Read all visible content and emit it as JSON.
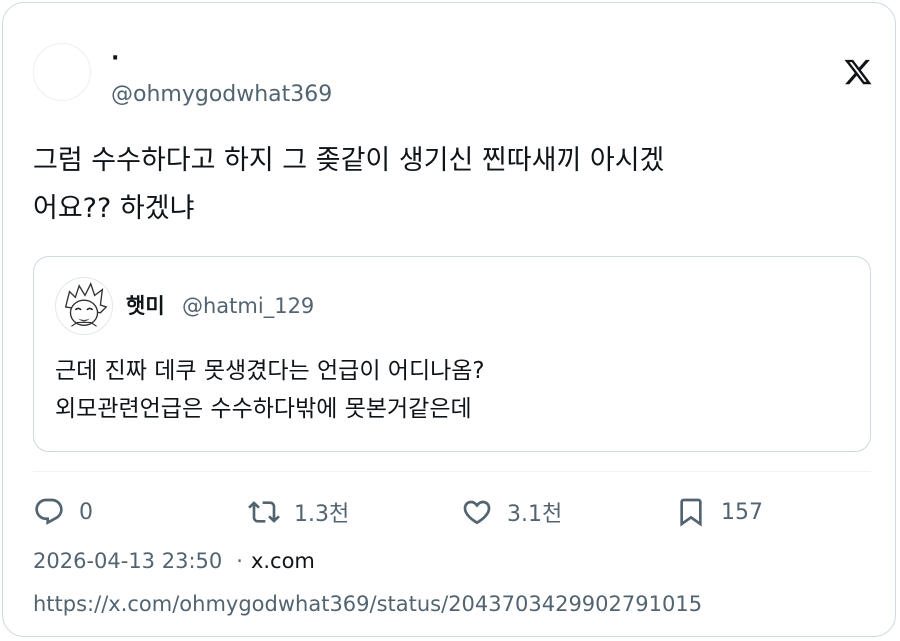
{
  "author": {
    "display_name": "·",
    "handle": "@ohmygodwhat369"
  },
  "tweet": {
    "text": "그럼 수수하다고 하지 그 좆같이 생기신 찐따새끼 아시겠\n어요?? 하겠냐"
  },
  "quoted": {
    "display_name": "햇미",
    "handle": "@hatmi_129",
    "text": "근데 진짜 데쿠 못생겼다는 언급이 어디나옴?\n외모관련언급은 수수하다밖에 못본거같은데"
  },
  "actions": {
    "replies": "0",
    "retweets": "1.3천",
    "likes": "3.1천",
    "bookmarks": "157"
  },
  "meta": {
    "timestamp": "2026-04-13 23:50",
    "separator": "·",
    "source": "x.com"
  },
  "url": "https://x.com/ohmygodwhat369/status/2043703429902791015",
  "icons": [
    "x-logo-icon",
    "reply-icon",
    "retweet-icon",
    "like-icon",
    "bookmark-icon"
  ],
  "colors": {
    "text": "#0f1419",
    "secondary": "#536471",
    "border": "#cfd9de"
  }
}
